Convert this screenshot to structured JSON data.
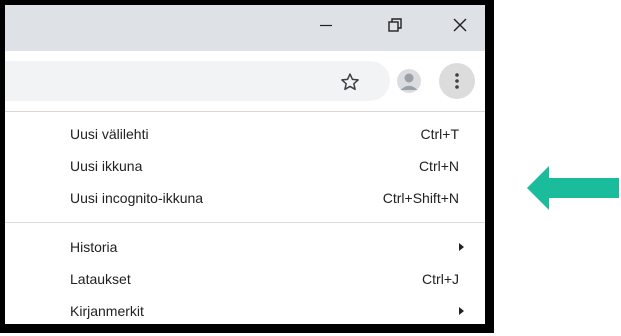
{
  "window": {
    "controls": {
      "minimize_icon": "minimize-icon",
      "restore_icon": "restore-icon",
      "close_icon": "close-icon"
    }
  },
  "toolbar": {
    "bookmark_icon": "star-icon",
    "profile_icon": "avatar-icon",
    "menu_icon": "kebab-menu-icon"
  },
  "menu": {
    "group1": [
      {
        "label": "Uusi välilehti",
        "shortcut": "Ctrl+T"
      },
      {
        "label": "Uusi ikkuna",
        "shortcut": "Ctrl+N"
      },
      {
        "label": "Uusi incognito-ikkuna",
        "shortcut": "Ctrl+Shift+N"
      }
    ],
    "group2": [
      {
        "label": "Historia",
        "shortcut": ""
      },
      {
        "label": "Lataukset",
        "shortcut": "Ctrl+J"
      },
      {
        "label": "Kirjanmerkit",
        "shortcut": ""
      }
    ]
  },
  "annotation": {
    "arrow_color": "#1abc9c"
  },
  "colors": {
    "titlebar": "#dee1e6",
    "omnibox": "#f1f3f4",
    "menu_button_active": "#dcdcdc",
    "text": "#202124"
  }
}
